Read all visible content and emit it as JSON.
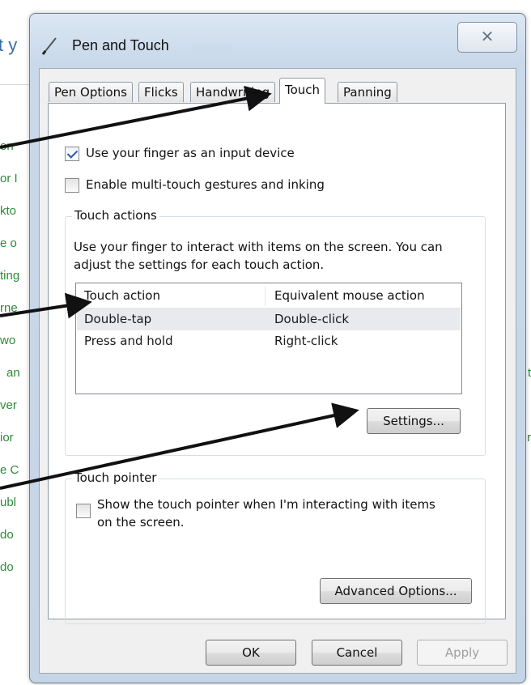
{
  "background": {
    "title": "t y",
    "left_items": [
      "on",
      "or I",
      "kto",
      "e o",
      "ting",
      "rne",
      "wo",
      "an",
      "ver",
      "ior",
      "e C",
      "ubl",
      "do",
      "do"
    ],
    "right_items": [
      "t",
      "r"
    ]
  },
  "dialog": {
    "title": "Pen and Touch",
    "title_ghost": "settings",
    "close_glyph": "✕",
    "tabs": [
      {
        "label": "Pen Options",
        "active": false
      },
      {
        "label": "Flicks",
        "active": false
      },
      {
        "label": "Handwriting",
        "active": false
      },
      {
        "label": "Touch",
        "active": true
      },
      {
        "label": "Panning",
        "active": false
      }
    ],
    "options": {
      "use_finger": {
        "label": "Use your finger as an input device",
        "checked": true
      },
      "multi_touch": {
        "label": "Enable multi-touch gestures and inking",
        "checked": false
      }
    },
    "touch_actions": {
      "group_label": "Touch actions",
      "description": "Use your finger to interact with items on the screen. You can adjust the settings for each touch action.",
      "columns": [
        "Touch action",
        "Equivalent mouse action"
      ],
      "rows": [
        {
          "action": "Double-tap",
          "mouse": "Double-click",
          "selected": true
        },
        {
          "action": "Press and hold",
          "mouse": "Right-click",
          "selected": false
        }
      ],
      "settings_button": "Settings..."
    },
    "touch_pointer": {
      "group_label": "Touch pointer",
      "show_pointer": {
        "label": "Show the touch pointer when I'm interacting with items on the screen.",
        "checked": false
      },
      "advanced_button": "Advanced Options..."
    },
    "buttons": {
      "ok": "OK",
      "cancel": "Cancel",
      "apply": "Apply"
    }
  },
  "colors": {
    "accent": "#2a5ba8",
    "window_frame": "#c9d9ea",
    "arrow": "#111111"
  }
}
